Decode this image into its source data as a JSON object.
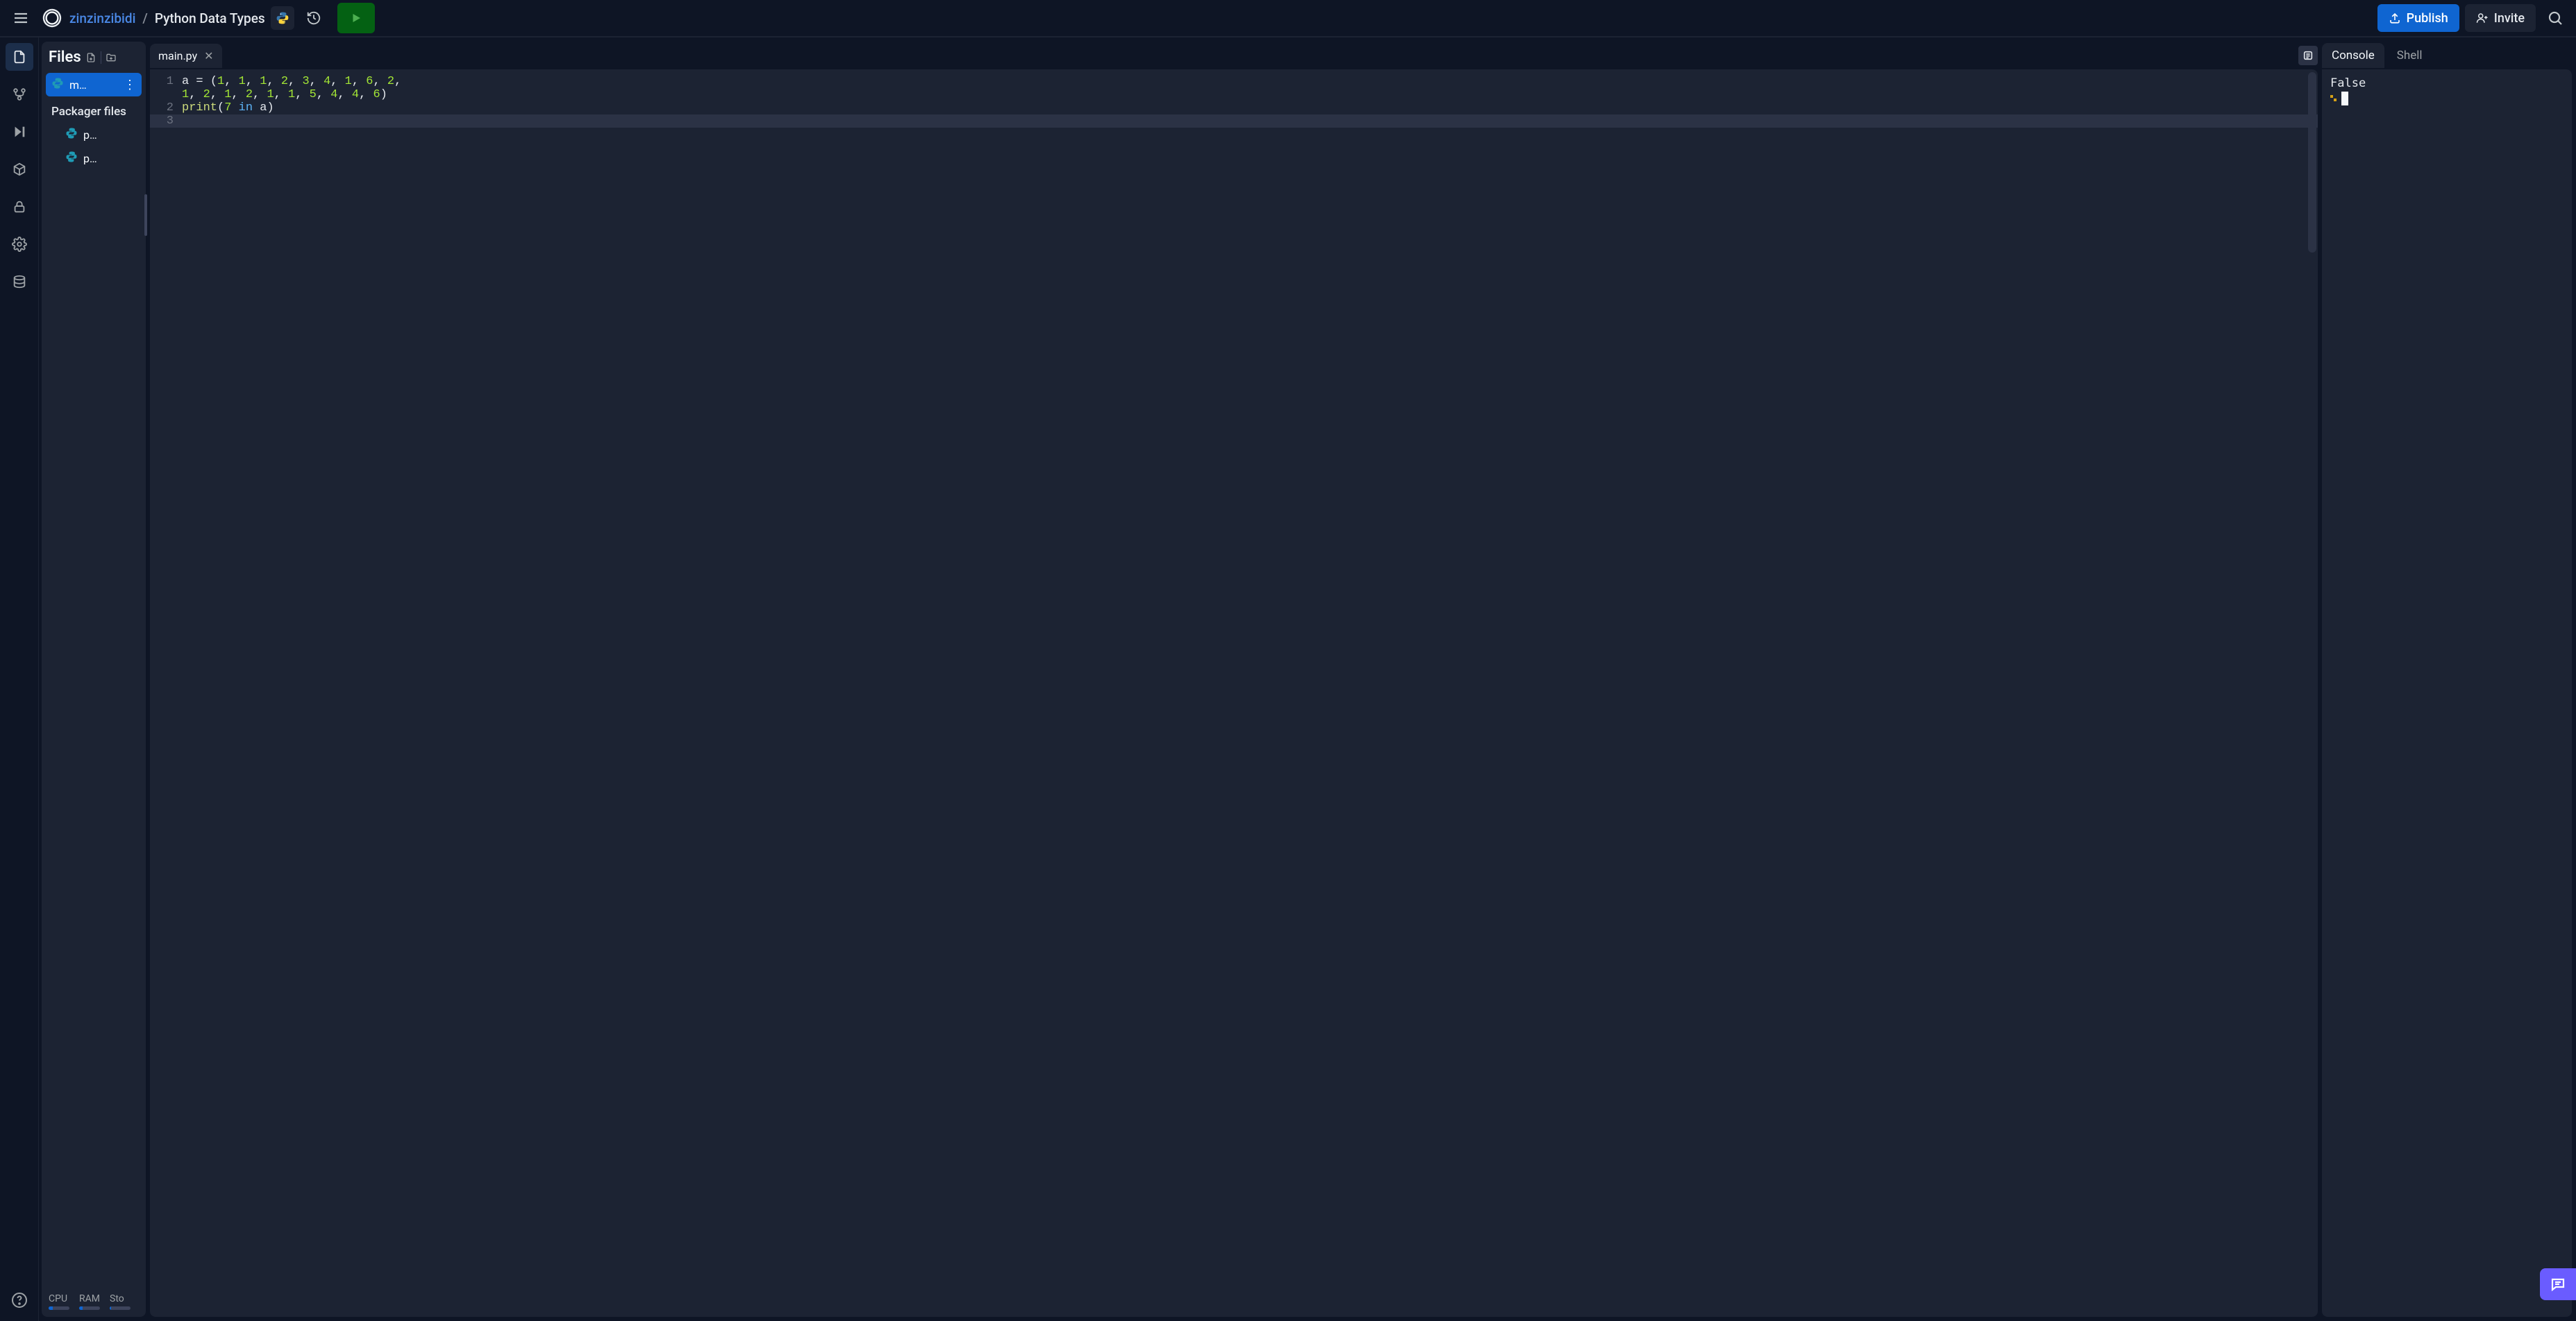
{
  "header": {
    "user": "zinzinzibidi",
    "separator": "/",
    "repl_name": "Python Data Types",
    "language_icon": "python",
    "publish_label": "Publish",
    "invite_label": "Invite"
  },
  "siderail": {
    "items": [
      {
        "name": "files-icon",
        "active": true
      },
      {
        "name": "version-control-icon",
        "active": false
      },
      {
        "name": "debugger-icon",
        "active": false
      },
      {
        "name": "packages-icon",
        "active": false
      },
      {
        "name": "secrets-icon",
        "active": false
      },
      {
        "name": "settings-icon",
        "active": false
      },
      {
        "name": "database-icon",
        "active": false
      }
    ],
    "help": {
      "name": "help-icon"
    }
  },
  "files_panel": {
    "title": "Files",
    "items": [
      {
        "label": "m…",
        "icon": "python",
        "active": true
      }
    ],
    "section_label": "Packager files",
    "packager_files": [
      {
        "label": "p…",
        "icon": "python"
      },
      {
        "label": "p…",
        "icon": "python"
      }
    ],
    "stats": {
      "cpu": {
        "label": "CPU",
        "pct": 20
      },
      "ram": {
        "label": "RAM",
        "pct": 18
      },
      "storage": {
        "label": "Sto",
        "pct": 8
      }
    }
  },
  "editor": {
    "tab": {
      "filename": "main.py"
    },
    "lines": [
      {
        "num": "1",
        "segments": [
          {
            "t": "a ",
            "c": "v"
          },
          {
            "t": "= ",
            "c": "op"
          },
          {
            "t": "(",
            "c": "p"
          },
          {
            "t": "1",
            "c": "n"
          },
          {
            "t": ", ",
            "c": "p"
          },
          {
            "t": "1",
            "c": "n"
          },
          {
            "t": ", ",
            "c": "p"
          },
          {
            "t": "1",
            "c": "n"
          },
          {
            "t": ", ",
            "c": "p"
          },
          {
            "t": "2",
            "c": "n"
          },
          {
            "t": ", ",
            "c": "p"
          },
          {
            "t": "3",
            "c": "n"
          },
          {
            "t": ", ",
            "c": "p"
          },
          {
            "t": "4",
            "c": "n"
          },
          {
            "t": ", ",
            "c": "p"
          },
          {
            "t": "1",
            "c": "n"
          },
          {
            "t": ", ",
            "c": "p"
          },
          {
            "t": "6",
            "c": "n"
          },
          {
            "t": ", ",
            "c": "p"
          },
          {
            "t": "2",
            "c": "n"
          },
          {
            "t": ", ",
            "c": "p"
          }
        ]
      },
      {
        "num": "",
        "segments": [
          {
            "t": "1",
            "c": "n"
          },
          {
            "t": ", ",
            "c": "p"
          },
          {
            "t": "2",
            "c": "n"
          },
          {
            "t": ", ",
            "c": "p"
          },
          {
            "t": "1",
            "c": "n"
          },
          {
            "t": ", ",
            "c": "p"
          },
          {
            "t": "2",
            "c": "n"
          },
          {
            "t": ", ",
            "c": "p"
          },
          {
            "t": "1",
            "c": "n"
          },
          {
            "t": ", ",
            "c": "p"
          },
          {
            "t": "1",
            "c": "n"
          },
          {
            "t": ", ",
            "c": "p"
          },
          {
            "t": "5",
            "c": "n"
          },
          {
            "t": ", ",
            "c": "p"
          },
          {
            "t": "4",
            "c": "n"
          },
          {
            "t": ", ",
            "c": "p"
          },
          {
            "t": "4",
            "c": "n"
          },
          {
            "t": ", ",
            "c": "p"
          },
          {
            "t": "6",
            "c": "n"
          },
          {
            "t": ")",
            "c": "p"
          }
        ]
      },
      {
        "num": "2",
        "segments": [
          {
            "t": "print",
            "c": "fn"
          },
          {
            "t": "(",
            "c": "p"
          },
          {
            "t": "7 ",
            "c": "n"
          },
          {
            "t": "in",
            "c": "kw"
          },
          {
            "t": " a",
            "c": "v"
          },
          {
            "t": ")",
            "c": "p"
          }
        ]
      },
      {
        "num": "3",
        "segments": [],
        "current": true
      }
    ]
  },
  "console": {
    "tabs": [
      {
        "label": "Console",
        "active": true
      },
      {
        "label": "Shell",
        "active": false
      }
    ],
    "output": "False",
    "prompt_glyph": "›"
  }
}
